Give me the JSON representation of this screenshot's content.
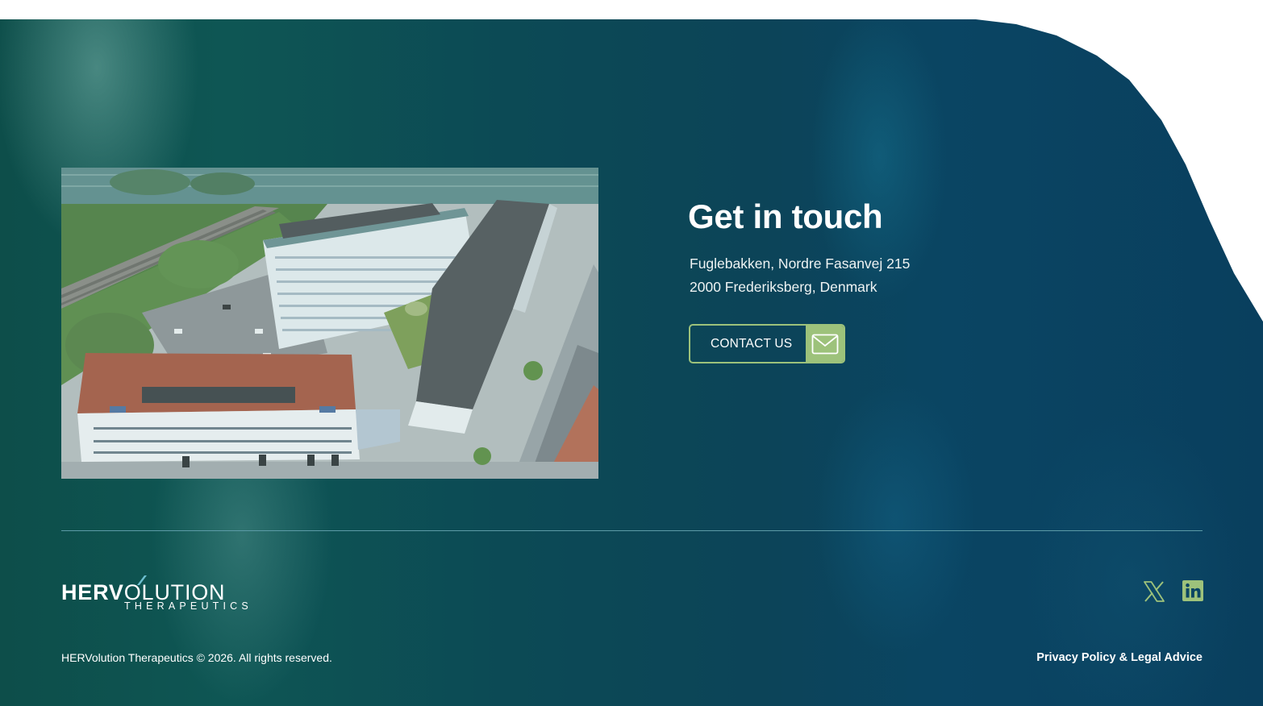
{
  "contact": {
    "heading": "Get in touch",
    "address_line1": "Fuglebakken, Nordre Fasanvej 215",
    "address_line2": "2000 Frederiksberg, Denmark",
    "button_label": "CONTACT US"
  },
  "footer": {
    "logo_main_bold": "HERV",
    "logo_main_light": "OLUTION",
    "logo_sub": "THERAPEUTICS",
    "copyright": "HERVolution Therapeutics © 2026. All rights reserved.",
    "legal_link": "Privacy Policy & Legal Advice",
    "social": [
      {
        "icon": "x-icon"
      },
      {
        "icon": "linkedin-icon"
      }
    ]
  },
  "colors": {
    "accent_green": "#9dc27b",
    "bg_teal": "#0c4a55",
    "bg_blue": "#093f5e"
  }
}
